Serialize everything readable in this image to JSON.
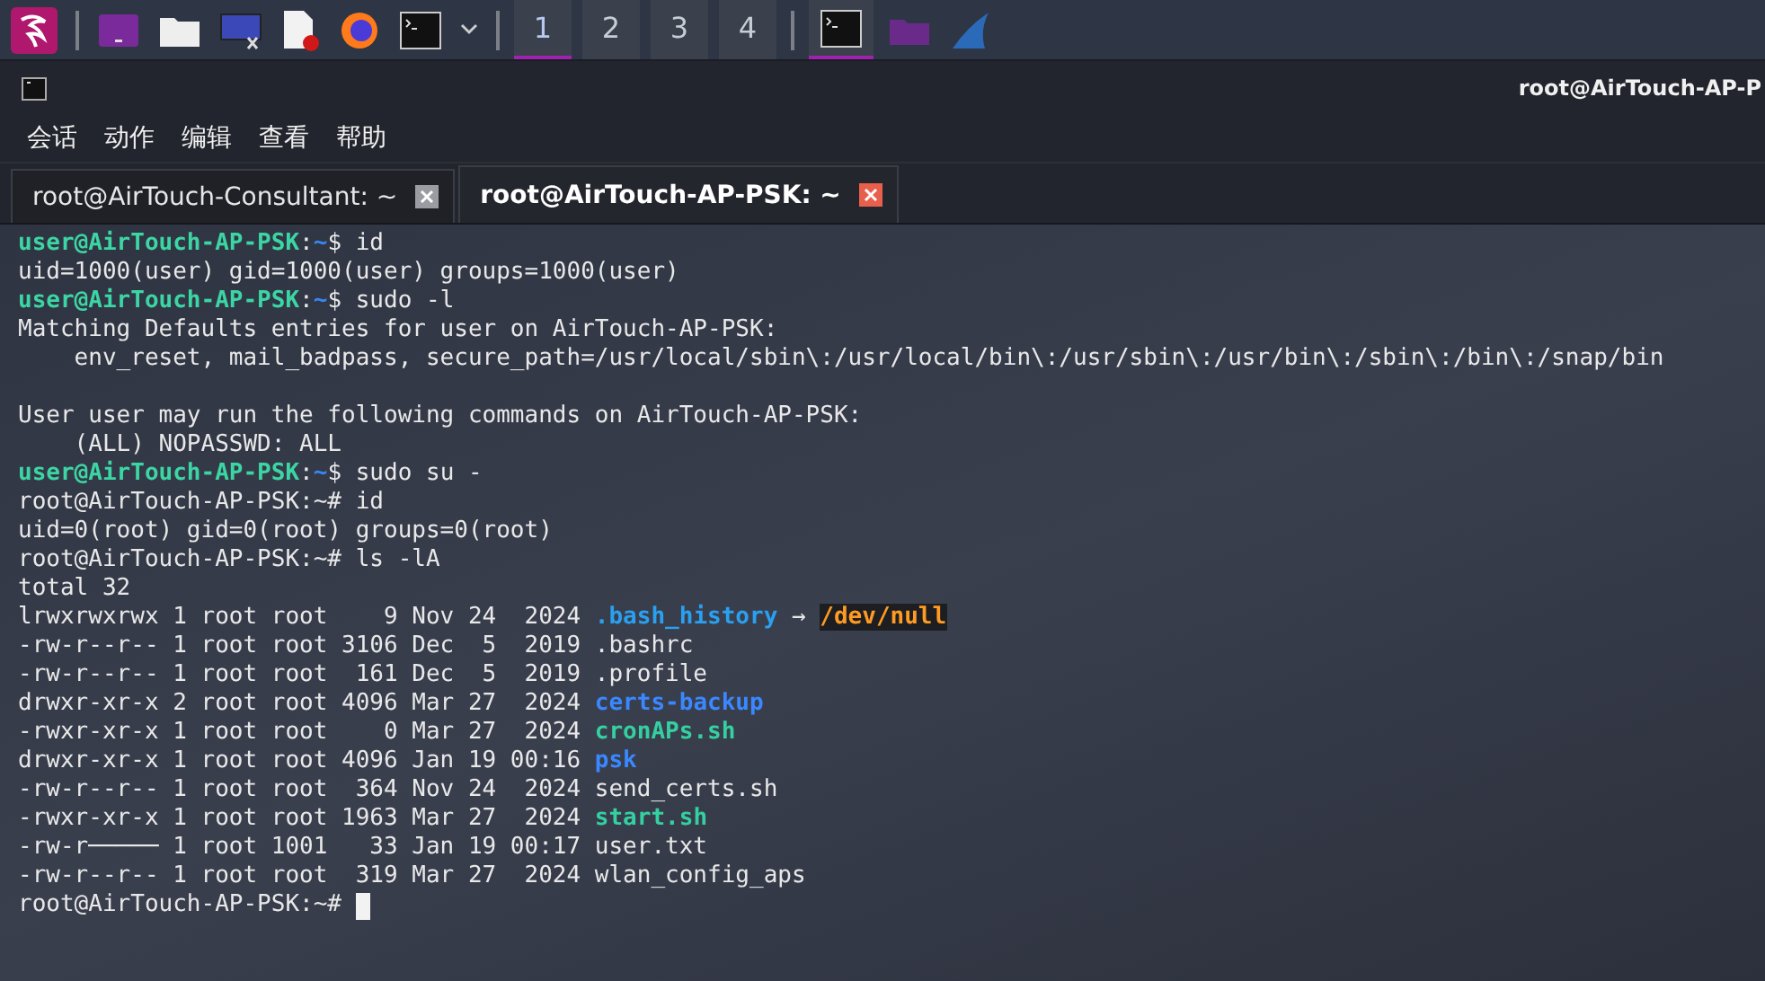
{
  "taskbar": {
    "workspaces": [
      {
        "label": "1",
        "selected": true
      },
      {
        "label": "2",
        "selected": false
      },
      {
        "label": "3",
        "selected": false
      },
      {
        "label": "4",
        "selected": false
      }
    ]
  },
  "window": {
    "title": "root@AirTouch-AP-P"
  },
  "menu": [
    "会话",
    "动作",
    "编辑",
    "查看",
    "帮助"
  ],
  "tabs": [
    {
      "label": "root@AirTouch-Consultant: ~",
      "selected": false
    },
    {
      "label": "root@AirTouch-AP-PSK: ~",
      "selected": true
    }
  ],
  "terminal": {
    "lines": [
      {
        "kind": "text",
        "segments": [
          {
            "text": "user@AirTouch-AP-PSK",
            "kind": "user"
          },
          {
            "text": ":",
            "kind": "plain"
          },
          {
            "text": "~",
            "kind": "cwd"
          },
          {
            "text": "$ id",
            "kind": "plain"
          }
        ]
      },
      {
        "kind": "text",
        "segments": [
          {
            "text": "uid=1000(user) gid=1000(user) groups=1000(user)",
            "kind": "plain"
          }
        ]
      },
      {
        "kind": "text",
        "segments": [
          {
            "text": "user@AirTouch-AP-PSK",
            "kind": "user"
          },
          {
            "text": ":",
            "kind": "plain"
          },
          {
            "text": "~",
            "kind": "cwd"
          },
          {
            "text": "$ sudo -l",
            "kind": "plain"
          }
        ]
      },
      {
        "kind": "text",
        "segments": [
          {
            "text": "Matching Defaults entries for user on AirTouch-AP-PSK:",
            "kind": "plain"
          }
        ]
      },
      {
        "kind": "text",
        "segments": [
          {
            "text": "    env_reset, mail_badpass, secure_path=/usr/local/sbin\\:/usr/local/bin\\:/usr/sbin\\:/usr/bin\\:/sbin\\:/bin\\:/snap/bin",
            "kind": "plain"
          }
        ]
      },
      {
        "kind": "blank"
      },
      {
        "kind": "text",
        "segments": [
          {
            "text": "User user may run the following commands on AirTouch-AP-PSK:",
            "kind": "plain"
          }
        ]
      },
      {
        "kind": "text",
        "segments": [
          {
            "text": "    (ALL) NOPASSWD: ALL",
            "kind": "plain"
          }
        ]
      },
      {
        "kind": "text",
        "segments": [
          {
            "text": "user@AirTouch-AP-PSK",
            "kind": "user"
          },
          {
            "text": ":",
            "kind": "plain"
          },
          {
            "text": "~",
            "kind": "cwd"
          },
          {
            "text": "$ sudo su -",
            "kind": "plain"
          }
        ]
      },
      {
        "kind": "text",
        "segments": [
          {
            "text": "root@AirTouch-AP-PSK:~# id",
            "kind": "plain"
          }
        ]
      },
      {
        "kind": "text",
        "segments": [
          {
            "text": "uid=0(root) gid=0(root) groups=0(root)",
            "kind": "plain"
          }
        ]
      },
      {
        "kind": "text",
        "segments": [
          {
            "text": "root@AirTouch-AP-PSK:~# ls -lA",
            "kind": "plain"
          }
        ]
      },
      {
        "kind": "text",
        "segments": [
          {
            "text": "total 32",
            "kind": "plain"
          }
        ]
      },
      {
        "kind": "text",
        "segments": [
          {
            "text": "lrwxrwxrwx 1 root root    9 Nov 24  2024 ",
            "kind": "plain"
          },
          {
            "text": ".bash_history",
            "kind": "link"
          },
          {
            "text": " → ",
            "kind": "plain"
          },
          {
            "text": "/dev/null",
            "kind": "device"
          }
        ]
      },
      {
        "kind": "text",
        "segments": [
          {
            "text": "-rw-r--r-- 1 root root 3106 Dec  5  2019 .bashrc",
            "kind": "plain"
          }
        ]
      },
      {
        "kind": "text",
        "segments": [
          {
            "text": "-rw-r--r-- 1 root root  161 Dec  5  2019 .profile",
            "kind": "plain"
          }
        ]
      },
      {
        "kind": "text",
        "segments": [
          {
            "text": "drwxr-xr-x 2 root root 4096 Mar 27  2024 ",
            "kind": "plain"
          },
          {
            "text": "certs-backup",
            "kind": "dir"
          }
        ]
      },
      {
        "kind": "text",
        "segments": [
          {
            "text": "-rwxr-xr-x 1 root root    0 Mar 27  2024 ",
            "kind": "plain"
          },
          {
            "text": "cronAPs.sh",
            "kind": "exec"
          }
        ]
      },
      {
        "kind": "text",
        "segments": [
          {
            "text": "drwxr-xr-x 1 root root 4096 Jan 19 00:16 ",
            "kind": "plain"
          },
          {
            "text": "psk",
            "kind": "dir"
          }
        ]
      },
      {
        "kind": "text",
        "segments": [
          {
            "text": "-rw-r--r-- 1 root root  364 Nov 24  2024 send_certs.sh",
            "kind": "plain"
          }
        ]
      },
      {
        "kind": "text",
        "segments": [
          {
            "text": "-rwxr-xr-x 1 root root 1963 Mar 27  2024 ",
            "kind": "plain"
          },
          {
            "text": "start.sh",
            "kind": "exec"
          }
        ]
      },
      {
        "kind": "text",
        "segments": [
          {
            "text": "-rw-r───── 1 root 1001   33 Jan 19 00:17 user.txt",
            "kind": "plain"
          }
        ]
      },
      {
        "kind": "text",
        "segments": [
          {
            "text": "-rw-r--r-- 1 root root  319 Mar 27  2024 wlan_config_aps",
            "kind": "plain"
          }
        ]
      },
      {
        "kind": "text",
        "segments": [
          {
            "text": "root@AirTouch-AP-PSK:~# ",
            "kind": "plain"
          }
        ]
      }
    ]
  }
}
